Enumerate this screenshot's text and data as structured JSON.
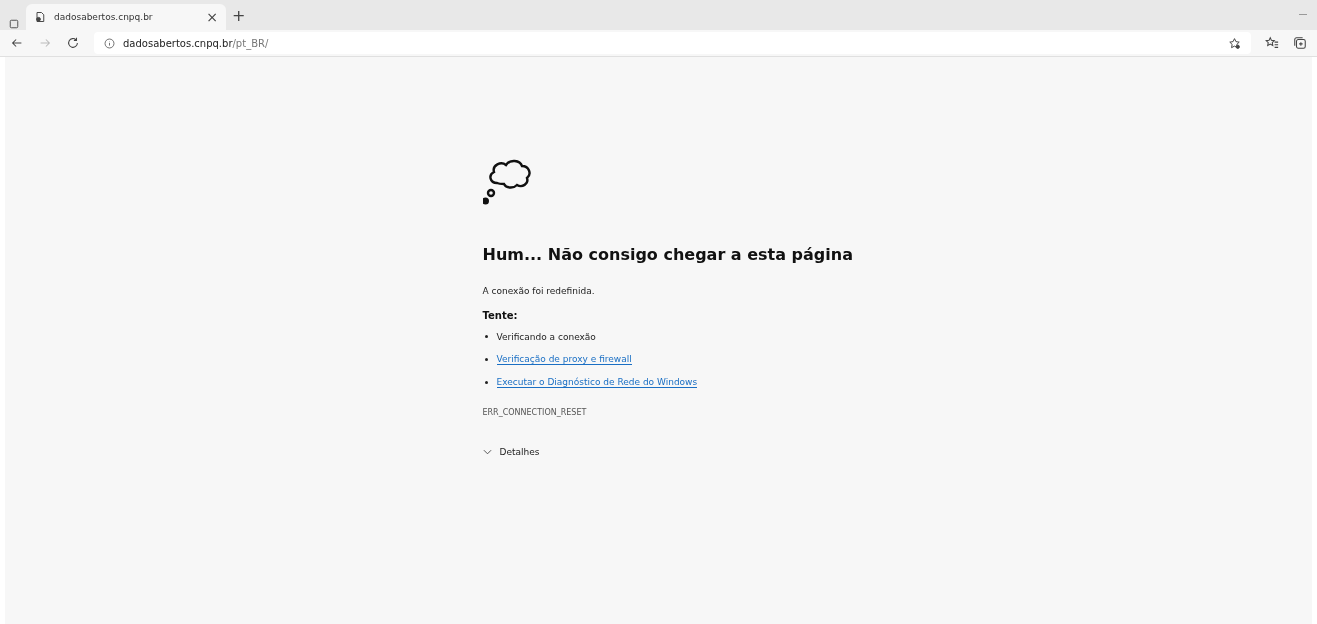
{
  "tab": {
    "title": "dadosabertos.cnpq.br",
    "close": "×",
    "selected": true
  },
  "new_tab": "+",
  "address": {
    "host": "dadosabertos.cnpq.br",
    "path": "/pt_BR/"
  },
  "error": {
    "heading": "Hum... Não consigo chegar a esta página",
    "message": "A conexão foi redefinida.",
    "try_label": "Tente:",
    "suggestions": [
      {
        "kind": "text",
        "text": "Verificando a conexão"
      },
      {
        "kind": "link",
        "text": "Verificação de proxy e firewall"
      },
      {
        "kind": "link",
        "text": "Executar o Diagnóstico de Rede do Windows"
      }
    ],
    "code": "ERR_CONNECTION_RESET",
    "details": {
      "label": "Detalhes",
      "expanded": false
    }
  }
}
